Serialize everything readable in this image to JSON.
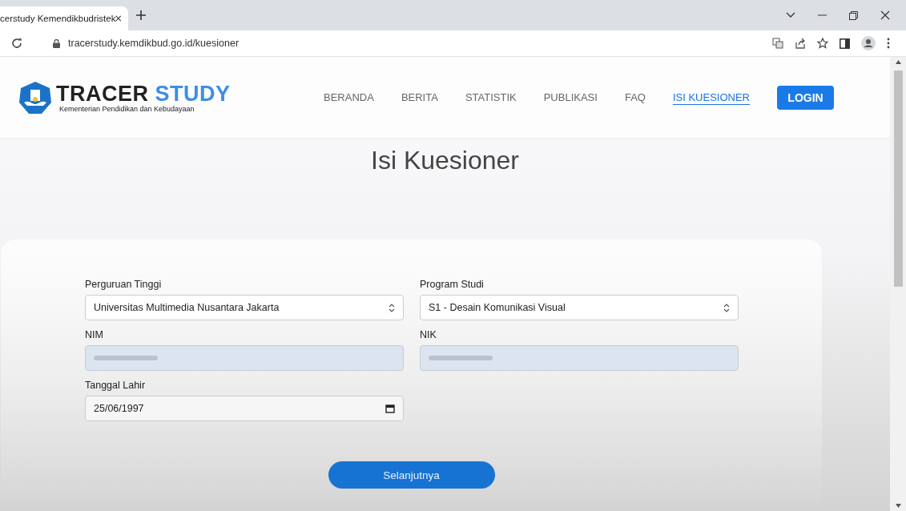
{
  "browser": {
    "tab_title": "cerstudy Kemendikbudristek",
    "address": "tracerstudy.kemdikbud.go.id/kuesioner"
  },
  "header": {
    "logo_title_dark": "TRACER",
    "logo_title_accent": "STUDY",
    "logo_subtitle": "Kementerian Pendidikan dan Kebudayaan",
    "nav": [
      {
        "label": "BERANDA",
        "selected": false
      },
      {
        "label": "BERITA",
        "selected": false
      },
      {
        "label": "STATISTIK",
        "selected": false
      },
      {
        "label": "PUBLIKASI",
        "selected": false
      },
      {
        "label": "FAQ",
        "selected": false
      },
      {
        "label": "ISI KUESIONER",
        "selected": true
      }
    ],
    "login_button": "LOGIN"
  },
  "page_title": "Isi Kuesioner",
  "form": {
    "fields": [
      {
        "label": "Perguruan Tinggi",
        "kind": "select",
        "value": "Universitas Multimedia Nusantara Jakarta"
      },
      {
        "label": "Program Studi",
        "kind": "select",
        "value": "S1 - Desain Komunikasi Visual"
      },
      {
        "label": "NIM",
        "kind": "blurred"
      },
      {
        "label": "NIK",
        "kind": "blurred"
      },
      {
        "label": "Tanggal Lahir",
        "kind": "date",
        "value": "25/06/1997"
      }
    ],
    "submit_button": "Selanjutnya"
  }
}
